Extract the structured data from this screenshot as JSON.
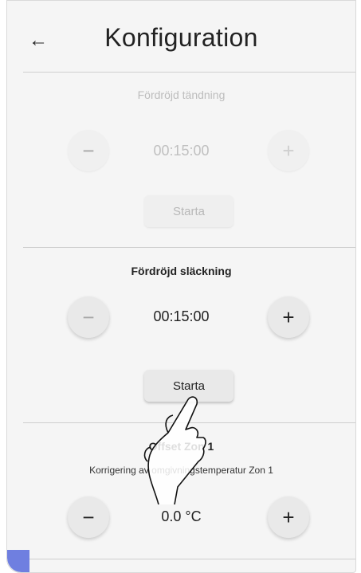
{
  "header": {
    "title": "Konfiguration",
    "back_icon": "arrow-left-icon"
  },
  "sections": [
    {
      "title": "Fördröjd tändning",
      "value": "00:15:00",
      "start_label": "Starta",
      "enabled": false
    },
    {
      "title": "Fördröjd släckning",
      "value": "00:15:00",
      "start_label": "Starta",
      "enabled": true
    },
    {
      "title": "Offset Zon 1",
      "subtitle": "Korrigering av omgivningstemperatur Zon 1",
      "value": "0.0 °C",
      "enabled": true
    }
  ],
  "icons": {
    "minus": "−",
    "plus": "+"
  },
  "colors": {
    "background": "#f5f5f5",
    "accent": "#6f7fe0"
  }
}
